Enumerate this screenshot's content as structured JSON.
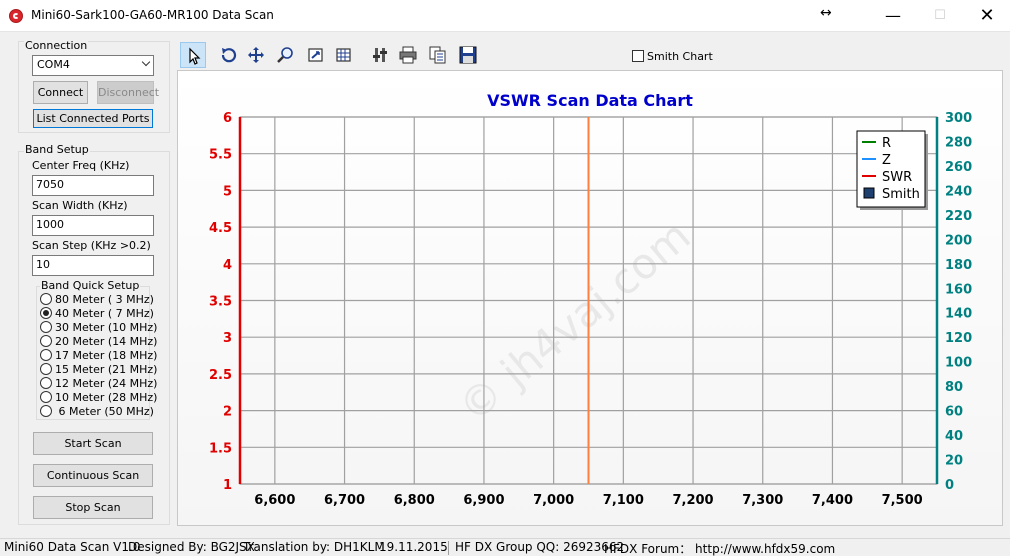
{
  "window": {
    "title": "Mini60-Sark100-GA60-MR100 Data Scan",
    "resize_glyph": "↔",
    "minimize": "—",
    "maximize": "☐",
    "close": "✕"
  },
  "connection": {
    "group_label": "Connection",
    "port_value": "COM4",
    "connect_label": "Connect",
    "disconnect_label": "Disconnect",
    "list_ports_label": "List Connected Ports"
  },
  "band_setup": {
    "group_label": "Band Setup",
    "center_freq_label": "Center Freq  (KHz)",
    "center_freq_value": "7050",
    "scan_width_label": "Scan Width   (KHz)",
    "scan_width_value": "1000",
    "scan_step_label": "Scan Step     (KHz >0.2)",
    "scan_step_value": "10",
    "quick_setup_label": "Band Quick Setup",
    "bands": [
      {
        "label": "80 Meter (  3 MHz)",
        "selected": false
      },
      {
        "label": "40 Meter (  7 MHz)",
        "selected": true
      },
      {
        "label": "30 Meter (10 MHz)",
        "selected": false
      },
      {
        "label": "20 Meter (14 MHz)",
        "selected": false
      },
      {
        "label": "17 Meter (18 MHz)",
        "selected": false
      },
      {
        "label": "15 Meter (21 MHz)",
        "selected": false
      },
      {
        "label": "12 Meter (24 MHz)",
        "selected": false
      },
      {
        "label": "10 Meter (28 MHz)",
        "selected": false
      },
      {
        "label": " 6 Meter  (50 MHz)",
        "selected": false
      }
    ]
  },
  "actions": {
    "start_scan": "Start Scan",
    "continuous_scan": "Continuous Scan",
    "stop_scan": "Stop Scan"
  },
  "toolbar": {
    "icons": [
      "pointer-icon",
      "undo-icon",
      "move-icon",
      "zoom-icon",
      "zoom-window-icon",
      "grid-settings-icon",
      "tools-icon",
      "print-icon",
      "copy-icon",
      "save-icon"
    ],
    "smith_chart_label": "Smith Chart",
    "smith_chart_checked": false
  },
  "chart_data": {
    "type": "line",
    "title": "VSWR Scan Data Chart",
    "watermark": "© jh4vaj.com",
    "xlim": [
      6550,
      7550
    ],
    "x_ticks": [
      "6,600",
      "6,700",
      "6,800",
      "6,900",
      "7,000",
      "7,100",
      "7,200",
      "7,300",
      "7,400",
      "7,500"
    ],
    "x_tick_values": [
      6600,
      6700,
      6800,
      6900,
      7000,
      7100,
      7200,
      7300,
      7400,
      7500
    ],
    "ylim_left": [
      1,
      6
    ],
    "y_left_ticks": [
      "1",
      "1.5",
      "2",
      "2.5",
      "3",
      "3.5",
      "4",
      "4.5",
      "5",
      "5.5",
      "6"
    ],
    "ylim_right": [
      0,
      300
    ],
    "y_right_ticks": [
      "0",
      "20",
      "40",
      "60",
      "80",
      "100",
      "120",
      "140",
      "160",
      "180",
      "200",
      "220",
      "240",
      "260",
      "280",
      "300"
    ],
    "center_marker_x": 7050,
    "grid": true,
    "legend_position": "top-right",
    "series": [
      {
        "name": "R",
        "color": "#008000",
        "values": []
      },
      {
        "name": "Z",
        "color": "#1e90ff",
        "values": []
      },
      {
        "name": "SWR",
        "color": "#e00000",
        "values": []
      },
      {
        "name": "Smith",
        "color": "#1f3f6f",
        "values": []
      }
    ],
    "colors": {
      "title": "#0000cc",
      "left_axis": "#e00000",
      "right_axis": "#008080",
      "marker": "#ff7f3f",
      "grid": "#a0a0a0"
    }
  },
  "status": {
    "version": "Mini60 Data Scan V1.0",
    "designer": "Designed By: BG2JSX",
    "translator": "Translation by: DH1KLM",
    "date": "19.11.2015",
    "group": "HF DX Group QQ: 26923662",
    "forum": "HFDX Forum：  http://www.hfdx59.com"
  }
}
